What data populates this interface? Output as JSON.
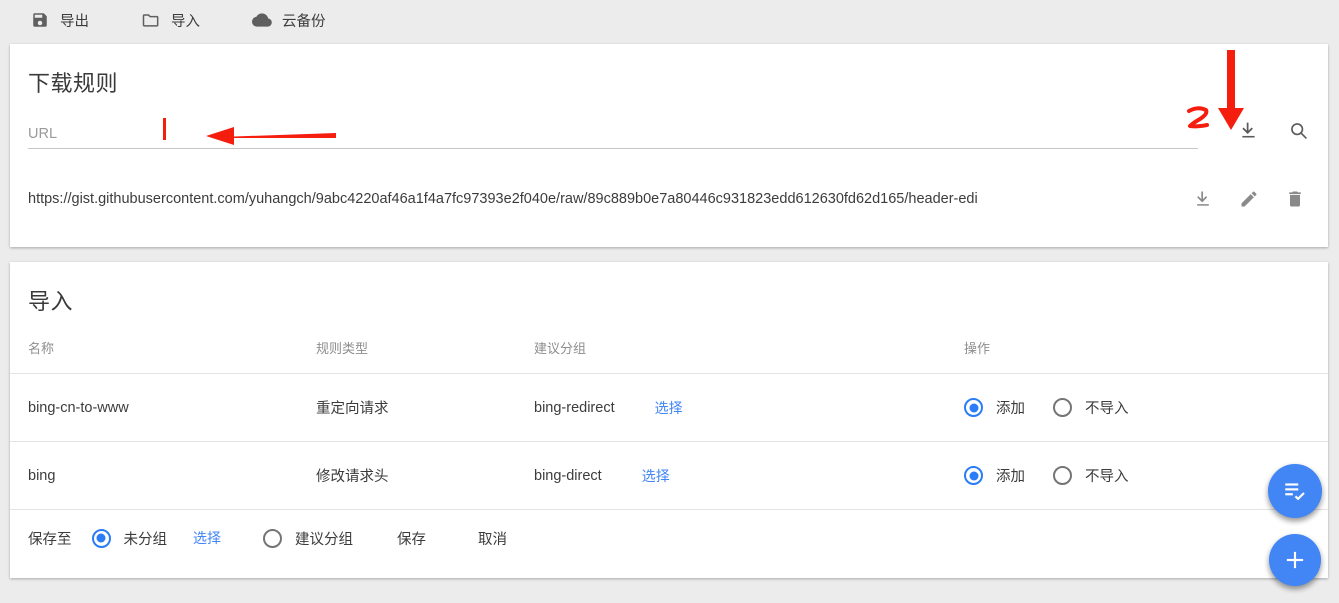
{
  "toolbar": {
    "items": [
      {
        "label": "导出",
        "icon": "save-icon"
      },
      {
        "label": "导入",
        "icon": "folder-icon"
      },
      {
        "label": "云备份",
        "icon": "cloud-icon"
      }
    ]
  },
  "rules_card": {
    "title": "下载规则",
    "url_input": {
      "value": "",
      "placeholder": "URL"
    },
    "header_actions": [
      {
        "name": "download-icon",
        "tooltip": "下载"
      },
      {
        "name": "search-icon",
        "tooltip": "搜索"
      }
    ],
    "url_entries": [
      {
        "url": "https://gist.githubusercontent.com/yuhangch/9abc4220af46a1f4a7fc97393e2f040e/raw/89c889b0e7a80446c931823edd612630fd62d165/header-edi",
        "actions": [
          "download-icon",
          "edit-icon",
          "delete-icon"
        ]
      }
    ]
  },
  "import_card": {
    "title": "导入",
    "columns": [
      "名称",
      "规则类型",
      "建议分组",
      "操作"
    ],
    "rows": [
      {
        "name": "bing-cn-to-www",
        "type": "重定向请求",
        "group": "bing-redirect",
        "group_link": "选择",
        "options": [
          {
            "label": "添加",
            "selected": true
          },
          {
            "label": "不导入",
            "selected": false
          }
        ]
      },
      {
        "name": "bing",
        "type": "修改请求头",
        "group": "bing-direct",
        "group_link": "选择",
        "options": [
          {
            "label": "添加",
            "selected": true
          },
          {
            "label": "不导入",
            "selected": false
          }
        ]
      }
    ],
    "save_bar": {
      "label": "保存至",
      "option_ungrouped": {
        "label": "未分组",
        "selected": true
      },
      "select_link": "选择",
      "option_suggested": {
        "label": "建议分组",
        "selected": false
      },
      "save_label": "保存",
      "cancel_label": "取消"
    }
  },
  "fabs": [
    {
      "name": "batch-check-fab",
      "icon": "playlist-check-icon"
    },
    {
      "name": "add-fab",
      "icon": "plus-icon"
    }
  ],
  "annotations": {
    "marker_one": "1",
    "marker_two": "2",
    "accent_red": "#f41d0e"
  },
  "colors": {
    "accent_blue": "#4285f4",
    "radio_blue": "#2b7cf7",
    "page_background": "#ececec",
    "card_background": "#ffffff"
  }
}
